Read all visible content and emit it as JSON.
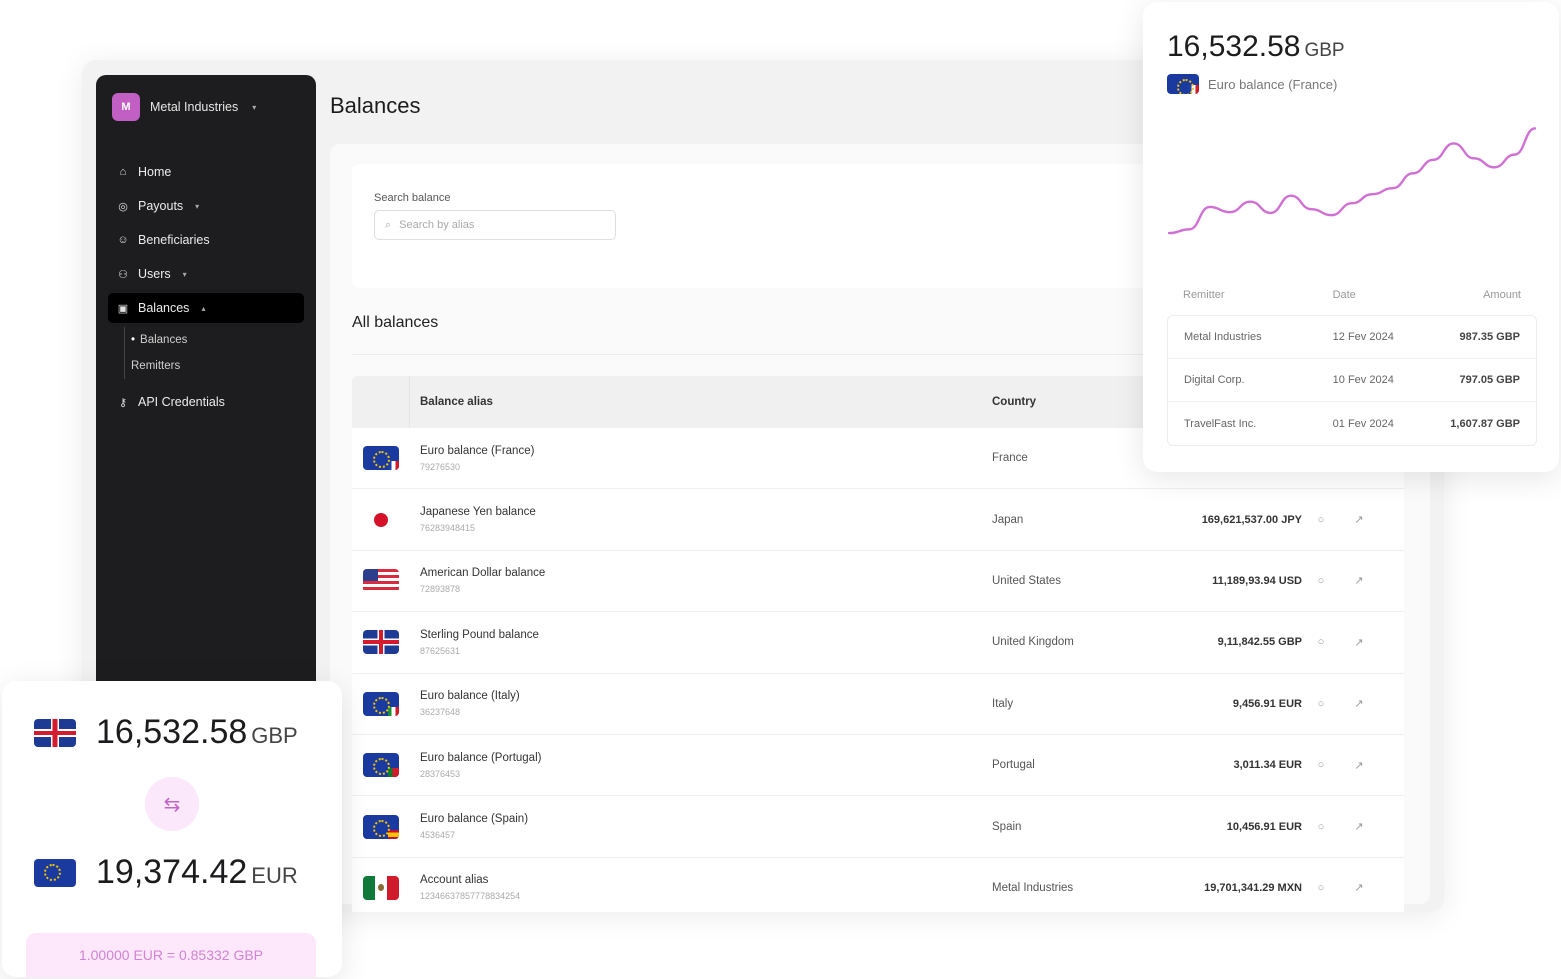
{
  "sidebar": {
    "org_initial": "M",
    "org_name": "Metal Industries",
    "items": [
      {
        "label": "Home",
        "icon": "home-icon"
      },
      {
        "label": "Payouts",
        "icon": "payouts-icon"
      },
      {
        "label": "Beneficiaries",
        "icon": "person-icon"
      },
      {
        "label": "Users",
        "icon": "users-icon"
      },
      {
        "label": "Balances",
        "icon": "balances-icon"
      },
      {
        "label": "API Credentials",
        "icon": "key-icon"
      }
    ],
    "sub_items": [
      "Balances",
      "Remitters"
    ]
  },
  "page": {
    "title": "Balances",
    "search_label": "Search balance",
    "search_placeholder": "Search by alias",
    "section_title": "All balances"
  },
  "table": {
    "headers": {
      "alias": "Balance alias",
      "country": "Country"
    },
    "rows": [
      {
        "flag": "eu-fr",
        "alias": "Euro balance (France)",
        "id": "79276530",
        "country": "France",
        "amount": ""
      },
      {
        "flag": "jp",
        "alias": "Japanese Yen balance",
        "id": "76283948415",
        "country": "Japan",
        "amount": "169,621,537.00 JPY"
      },
      {
        "flag": "us",
        "alias": "American Dollar balance",
        "id": "72893878",
        "country": "United States",
        "amount": "11,189,93.94 USD"
      },
      {
        "flag": "uk",
        "alias": "Sterling Pound balance",
        "id": "87625631",
        "country": "United Kingdom",
        "amount": "9,11,842.55 GBP"
      },
      {
        "flag": "eu-it",
        "alias": "Euro balance (Italy)",
        "id": "36237648",
        "country": "Italy",
        "amount": "9,456.91 EUR"
      },
      {
        "flag": "eu-pt",
        "alias": "Euro balance (Portugal)",
        "id": "28376453",
        "country": "Portugal",
        "amount": "3,011.34 EUR"
      },
      {
        "flag": "eu-es",
        "alias": "Euro balance (Spain)",
        "id": "4536457",
        "country": "Spain",
        "amount": "10,456.91 EUR"
      },
      {
        "flag": "mx",
        "alias": "Account alias",
        "id": "12346637857778834254",
        "country": "Metal Industries",
        "amount": "19,701,341.29 MXN"
      }
    ]
  },
  "chart_card": {
    "amount": "16,532.58",
    "currency": "GBP",
    "balance_name": "Euro balance (France)",
    "line_color": "#d070d4",
    "headers": {
      "remitter": "Remitter",
      "date": "Date",
      "amount": "Amount"
    },
    "rows": [
      {
        "remitter": "Metal Industries",
        "date": "12 Fev 2024",
        "amount": "987.35 GBP"
      },
      {
        "remitter": "Digital Corp.",
        "date": "10 Fev 2024",
        "amount": "797.05 GBP"
      },
      {
        "remitter": "TravelFast Inc.",
        "date": "01 Fev 2024",
        "amount": "1,607.87 GBP"
      }
    ]
  },
  "chart_data": {
    "type": "line",
    "title": "",
    "xlabel": "",
    "ylabel": "",
    "grid": false,
    "series": [
      {
        "values": [
          20,
          25,
          55,
          48,
          62,
          47,
          70,
          52,
          44,
          60,
          72,
          80,
          100,
          118,
          140,
          120,
          108,
          125,
          160
        ]
      }
    ],
    "ylim": [
      0,
      170
    ]
  },
  "converter": {
    "from_amount": "16,532.58",
    "from_currency": "GBP",
    "to_amount": "19,374.42",
    "to_currency": "EUR",
    "swap_icon": "swap-icon",
    "rate": "1.00000 EUR = 0.85332 GBP"
  }
}
